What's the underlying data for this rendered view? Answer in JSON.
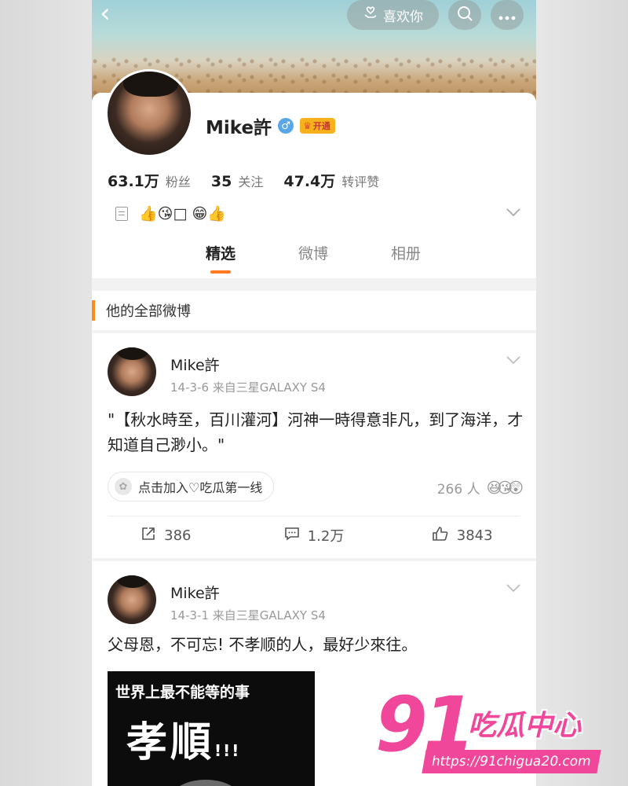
{
  "header": {
    "back_label": "‹",
    "like_label": "喜欢你",
    "search_icon": "search-icon",
    "more_icon": "more-icon"
  },
  "profile": {
    "name": "Mike許",
    "vip_label": "开通",
    "stats": [
      {
        "value": "63.1万",
        "label": "粉丝"
      },
      {
        "value": "35",
        "label": "关注"
      },
      {
        "value": "47.4万",
        "label": "转评赞"
      }
    ],
    "bio": "👍😘□ 😁👍",
    "tabs": [
      "精选",
      "微博",
      "相册"
    ],
    "active_tab": "精选"
  },
  "section_title": "他的全部微博",
  "posts": [
    {
      "author": "Mike許",
      "meta": "14-3-6   来自三星GALAXY S4",
      "text": "\"【秋水時至，百川灌河】河神一時得意非凡，到了海洋，才知道自己渺小。\"",
      "topic": "点击加入♡吃瓜第一线",
      "reaction_count": "266 人",
      "reaction_emojis": "😆😘😲",
      "reposts": "386",
      "comments": "1.2万",
      "likes": "3843"
    },
    {
      "author": "Mike許",
      "meta": "14-3-1   来自三星GALAXY S4",
      "text": "父母恩，不可忘! 不孝顺的人，最好少來往。",
      "image": {
        "line1": "世界上最不能等的事",
        "line2": "孝順",
        "exclaim": "!!!"
      }
    }
  ],
  "watermark": {
    "number": "91",
    "name": "吃瓜中心",
    "url": "https://91chigua20.com"
  }
}
